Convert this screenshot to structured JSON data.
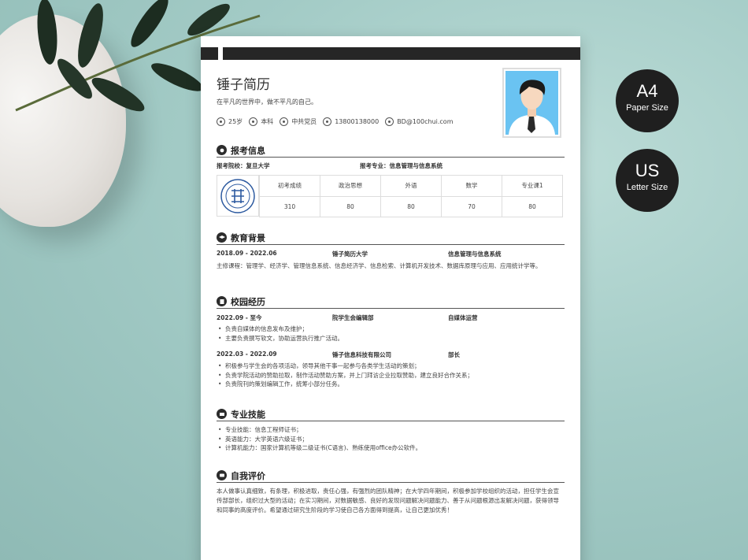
{
  "badges": {
    "a4": {
      "big": "A4",
      "small": "Paper Size"
    },
    "us": {
      "big": "US",
      "small": "Letter Size"
    }
  },
  "resume": {
    "name": "锤子简历",
    "motto": "在平凡的世界中，做不平凡的自己。",
    "infos": [
      "25岁",
      "本科",
      "中共党员",
      "13800138000",
      "BD@100chui.com"
    ]
  },
  "sections": {
    "apply": {
      "title": "报考信息",
      "school": "报考院校：复旦大学",
      "major": "报考专业：信息管理与信息系统",
      "score_headers": [
        "初考成绩",
        "政治思想",
        "外语",
        "数学",
        "专业课1"
      ],
      "score_values": [
        "310",
        "80",
        "80",
        "70",
        "80"
      ]
    },
    "education": {
      "title": "教育背景",
      "period": "2018.09 - 2022.06",
      "school": "锤子简历大学",
      "major": "信息管理与信息系统",
      "courses": "主修课程：管理学、经济学、管理信息系统、信息经济学、信息检索、计算机开发技术、数据库原理与应用、应用统计学等。"
    },
    "campus": {
      "title": "校园经历",
      "entries": [
        {
          "period": "2022.09 - 至今",
          "org": "院学生会编辑部",
          "role": "自媒体运营",
          "items": [
            "负责自媒体的信息发布及维护；",
            "主要负责撰写软文，协助运营执行推广活动。"
          ]
        },
        {
          "period": "2022.03 - 2022.09",
          "org": "锤子信息科技有限公司",
          "role": "部长",
          "items": [
            "积极参与学生会的各项活动，领导其他干事一起参与各类学生活动的策划；",
            "负责学院活动的赞助拉取，制作活动赞助方案，并上门拜访企业拉取赞助，建立良好合作关系；",
            "负责院刊的策划编辑工作，统筹小部分任务。"
          ]
        }
      ]
    },
    "skills": {
      "title": "专业技能",
      "items": [
        "专业技能：信息工程师证书；",
        "英语能力：大学英语六级证书；",
        "计算机能力：国家计算机等级二级证书(C语言)、熟练使用office办公软件。"
      ]
    },
    "self": {
      "title": "自我评价",
      "text": "本人做事认真细致，有条理，积极进取，责任心强，有强烈的团队精神；在大学四年期间，积极参加学校组织的活动，担任学生会宣传部部长，组织过大型的活动；在实习期间，对数据敏感、良好的发现问题解决问题能力、善于从问题根源出发解决问题，获得领导和同事的高度评价。希望通过研究生阶段的学习使自己各方面得到提高，让自己更加优秀！"
    }
  }
}
